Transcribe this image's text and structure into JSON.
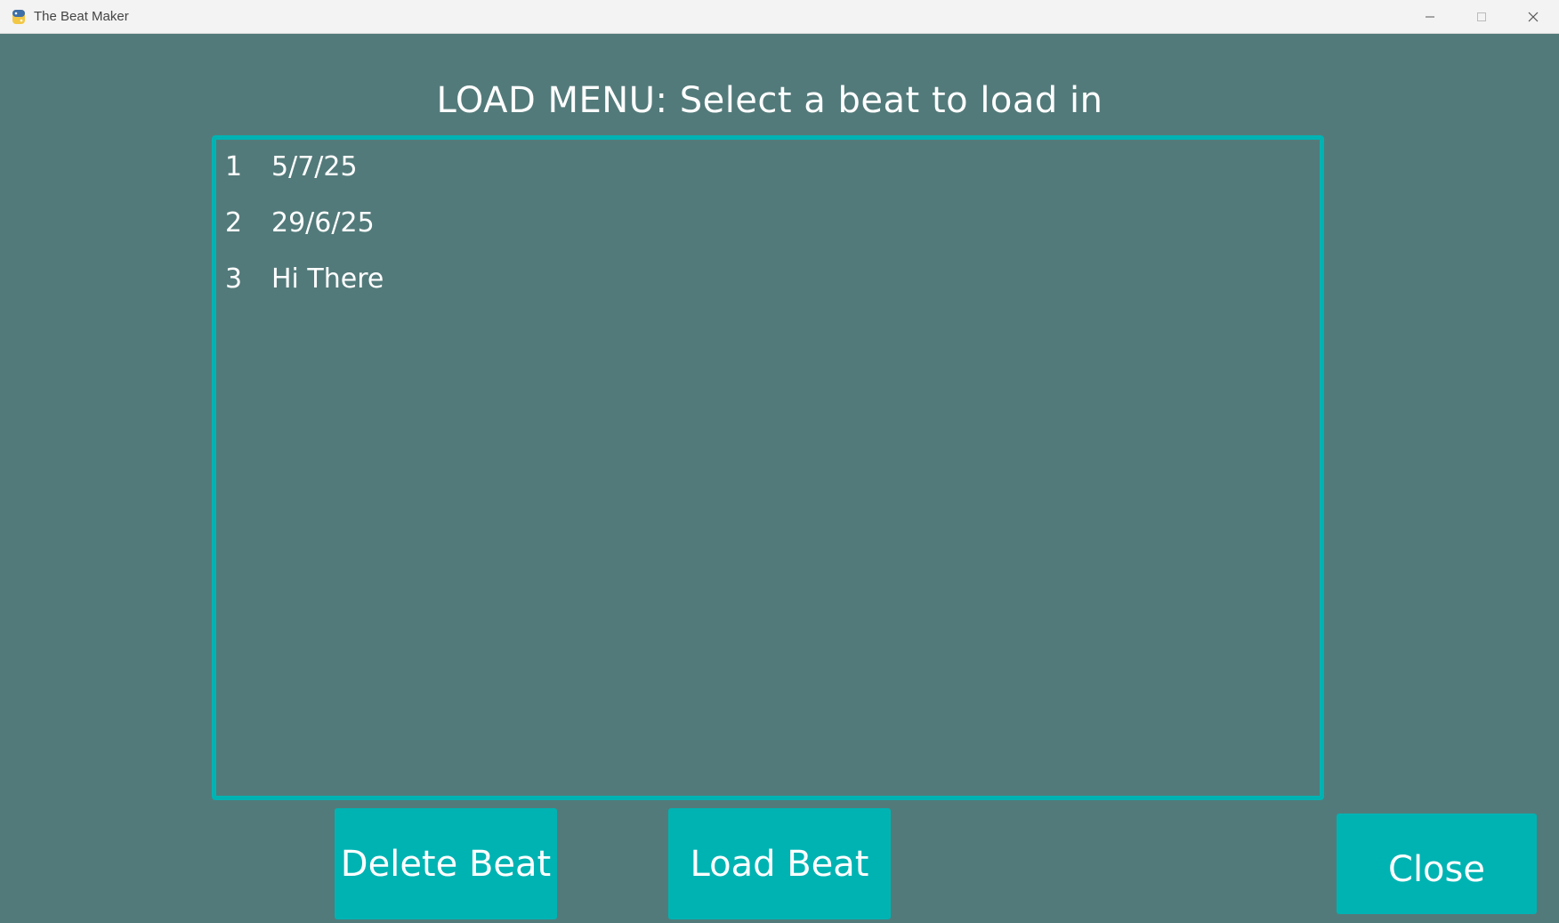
{
  "window": {
    "title": "The Beat Maker",
    "app_icon": "python-icon"
  },
  "load_menu": {
    "heading": "LOAD MENU: Select a beat to load in",
    "items": [
      {
        "index": "1",
        "name": "5/7/25"
      },
      {
        "index": "2",
        "name": "29/6/25"
      },
      {
        "index": "3",
        "name": "Hi There"
      }
    ]
  },
  "buttons": {
    "delete_label": "Delete Beat",
    "load_label": "Load Beat",
    "close_label": "Close"
  },
  "colors": {
    "background": "#537a7a",
    "accent": "#00b3b3",
    "text": "#ffffff"
  }
}
